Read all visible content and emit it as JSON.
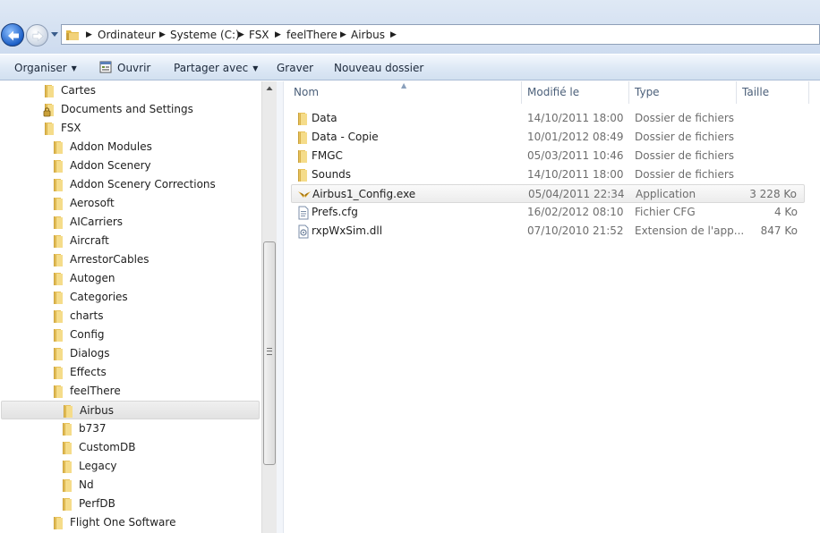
{
  "address": {
    "crumbs": [
      "Ordinateur",
      "Systeme (C:)",
      "FSX",
      "feelThere",
      "Airbus"
    ]
  },
  "toolbar": {
    "organize_label": "Organiser",
    "open_label": "Ouvrir",
    "share_label": "Partager avec",
    "burn_label": "Graver",
    "new_folder_label": "Nouveau dossier"
  },
  "nav": {
    "items": [
      {
        "label": "Cartes",
        "icon": "folder-icon"
      },
      {
        "label": "Documents and Settings",
        "icon": "locked-folder-icon"
      },
      {
        "label": "FSX",
        "icon": "folder-icon"
      },
      {
        "label": "Addon Modules",
        "icon": "folder-icon"
      },
      {
        "label": "Addon Scenery",
        "icon": "folder-icon"
      },
      {
        "label": "Addon Scenery Corrections",
        "icon": "folder-icon"
      },
      {
        "label": "Aerosoft",
        "icon": "folder-icon"
      },
      {
        "label": "AICarriers",
        "icon": "folder-icon"
      },
      {
        "label": "Aircraft",
        "icon": "folder-icon"
      },
      {
        "label": "ArrestorCables",
        "icon": "folder-icon"
      },
      {
        "label": "Autogen",
        "icon": "folder-icon"
      },
      {
        "label": "Categories",
        "icon": "folder-icon"
      },
      {
        "label": "charts",
        "icon": "folder-icon"
      },
      {
        "label": "Config",
        "icon": "folder-icon"
      },
      {
        "label": "Dialogs",
        "icon": "folder-icon"
      },
      {
        "label": "Effects",
        "icon": "folder-icon"
      },
      {
        "label": "feelThere",
        "icon": "folder-icon"
      },
      {
        "label": "Airbus",
        "icon": "folder-icon",
        "selected": true
      },
      {
        "label": "b737",
        "icon": "folder-icon"
      },
      {
        "label": "CustomDB",
        "icon": "folder-icon"
      },
      {
        "label": "Legacy",
        "icon": "folder-icon"
      },
      {
        "label": "Nd",
        "icon": "folder-icon"
      },
      {
        "label": "PerfDB",
        "icon": "folder-icon"
      },
      {
        "label": "Flight One Software",
        "icon": "folder-icon"
      }
    ]
  },
  "list": {
    "columns": {
      "name": "Nom",
      "modified": "Modifié le",
      "type": "Type",
      "size": "Taille"
    },
    "files": [
      {
        "name": "Data",
        "modified": "14/10/2011 18:00",
        "type": "Dossier de fichiers",
        "size": "",
        "icon": "folder-icon"
      },
      {
        "name": "Data - Copie",
        "modified": "10/01/2012 08:49",
        "type": "Dossier de fichiers",
        "size": "",
        "icon": "folder-icon"
      },
      {
        "name": "FMGC",
        "modified": "05/03/2011 10:46",
        "type": "Dossier de fichiers",
        "size": "",
        "icon": "folder-icon"
      },
      {
        "name": "Sounds",
        "modified": "14/10/2011 18:00",
        "type": "Dossier de fichiers",
        "size": "",
        "icon": "folder-icon"
      },
      {
        "name": "Airbus1_Config.exe",
        "modified": "05/04/2011 22:34",
        "type": "Application",
        "size": "3 228 Ko",
        "icon": "app-wings-icon"
      },
      {
        "name": "Prefs.cfg",
        "modified": "16/02/2012 08:10",
        "type": "Fichier CFG",
        "size": "4 Ko",
        "icon": "cfg-file-icon"
      },
      {
        "name": "rxpWxSim.dll",
        "modified": "07/10/2010 21:52",
        "type": "Extension de l'app...",
        "size": "847 Ko",
        "icon": "dll-file-icon"
      }
    ]
  },
  "colors": {
    "accent": "#1c5fc7",
    "folder": "#e8c25a",
    "toolbar_bg": "#dde8f5"
  }
}
